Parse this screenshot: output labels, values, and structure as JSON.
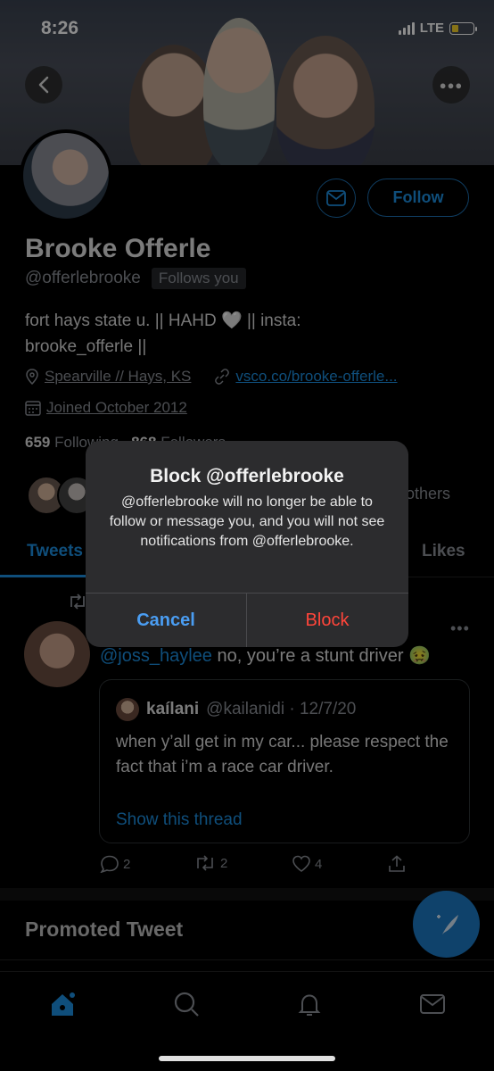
{
  "status": {
    "time": "8:26",
    "network": "LTE"
  },
  "profile": {
    "name": "Brooke Offerle",
    "handle": "@offerlebrooke",
    "follows_badge": "Follows you",
    "bio_line1": "fort hays state u. || HAHD 🤍 || insta:",
    "bio_line2": "brooke_offerle ||",
    "location": "Spearville // Hays, KS",
    "website": "vsco.co/brooke-offerle...",
    "joined": "Joined October 2012",
    "following_count": "659",
    "following_label": "Following",
    "followers_count": "868",
    "followers_label": "Followers",
    "others_text": "others",
    "follow_label": "Follow"
  },
  "tabs": {
    "tweets": "Tweets",
    "likes": "Likes"
  },
  "tweet": {
    "mention": "@joss_haylee",
    "text": " no, you’re a stunt driver 🤢",
    "quote": {
      "name": "kaílani",
      "handle_date": "@kailanidi · 12/7/20",
      "body": "when y’all get in my car... please respect the fact that i’m a race car driver.",
      "show_thread": "Show this thread"
    },
    "replies": "2",
    "retweets": "2",
    "likes": "4"
  },
  "promoted": "Promoted Tweet",
  "alert": {
    "title": "Block @offerlebrooke",
    "message": "@offerlebrooke will no longer be able to follow or message you, and you will not see notifications from @offerlebrooke.",
    "cancel": "Cancel",
    "confirm": "Block"
  },
  "colors": {
    "accent": "#1d8fe0",
    "destructive": "#ff453a",
    "alert_bg": "#2c2c2e"
  }
}
